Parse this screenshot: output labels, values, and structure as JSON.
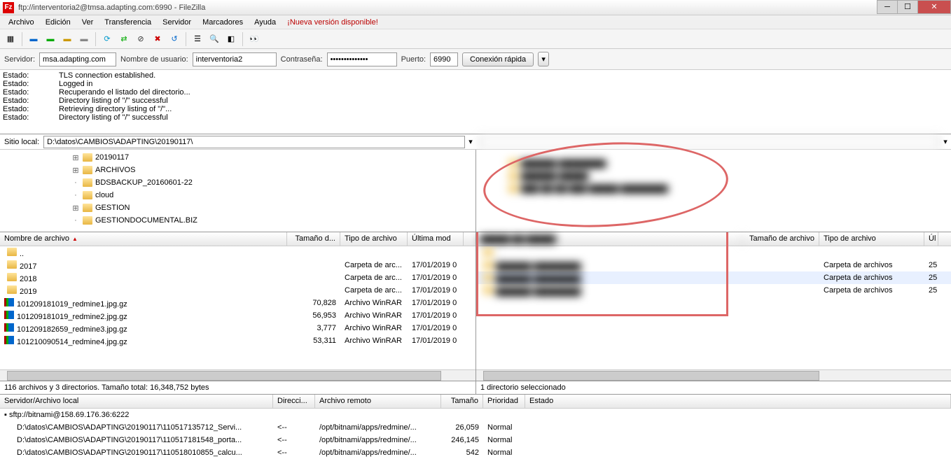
{
  "title": "ftp://interventoria2@tmsa.adapting.com:6990 - FileZilla",
  "menu": [
    "Archivo",
    "Edición",
    "Ver",
    "Transferencia",
    "Servidor",
    "Marcadores",
    "Ayuda"
  ],
  "update": "¡Nueva versión disponible!",
  "quickconnect": {
    "host_label": "Servidor:",
    "host": "msa.adapting.com",
    "user_label": "Nombre de usuario:",
    "user": "interventoria2",
    "pass_label": "Contraseña:",
    "pass": "••••••••••••••",
    "port_label": "Puerto:",
    "port": "6990",
    "button": "Conexión rápida"
  },
  "log": [
    {
      "label": "Estado:",
      "msg": "TLS connection established."
    },
    {
      "label": "Estado:",
      "msg": "Logged in"
    },
    {
      "label": "Estado:",
      "msg": "Recuperando el listado del directorio..."
    },
    {
      "label": "Estado:",
      "msg": "Directory listing of \"/\" successful"
    },
    {
      "label": "Estado:",
      "msg": "Retrieving directory listing of \"/\"..."
    },
    {
      "label": "Estado:",
      "msg": "Directory listing of \"/\" successful"
    }
  ],
  "local_path_label": "Sitio local:",
  "local_path": "D:\\datos\\CAMBIOS\\ADAPTING\\20190117\\",
  "local_tree": [
    {
      "exp": "+",
      "name": "20190117"
    },
    {
      "exp": "+",
      "name": "ARCHIVOS"
    },
    {
      "exp": "",
      "name": "BDSBACKUP_20160601-22"
    },
    {
      "exp": "",
      "name": "cloud"
    },
    {
      "exp": "+",
      "name": "GESTION"
    },
    {
      "exp": "",
      "name": "GESTIONDOCUMENTAL.BIZ"
    }
  ],
  "local_cols": {
    "name": "Nombre de archivo",
    "size": "Tamaño d...",
    "type": "Tipo de archivo",
    "mod": "Última mod"
  },
  "local_files": [
    {
      "icon": "folder",
      "name": "..",
      "size": "",
      "type": "",
      "mod": ""
    },
    {
      "icon": "folder",
      "name": "2017",
      "size": "",
      "type": "Carpeta de arc...",
      "mod": "17/01/2019 0"
    },
    {
      "icon": "folder",
      "name": "2018",
      "size": "",
      "type": "Carpeta de arc...",
      "mod": "17/01/2019 0"
    },
    {
      "icon": "folder",
      "name": "2019",
      "size": "",
      "type": "Carpeta de arc...",
      "mod": "17/01/2019 0"
    },
    {
      "icon": "gz",
      "name": "101209181019_redmine1.jpg.gz",
      "size": "70,828",
      "type": "Archivo WinRAR",
      "mod": "17/01/2019 0"
    },
    {
      "icon": "gz",
      "name": "101209181019_redmine2.jpg.gz",
      "size": "56,953",
      "type": "Archivo WinRAR",
      "mod": "17/01/2019 0"
    },
    {
      "icon": "gz",
      "name": "101209182659_redmine3.jpg.gz",
      "size": "3,777",
      "type": "Archivo WinRAR",
      "mod": "17/01/2019 0"
    },
    {
      "icon": "gz",
      "name": "101210090514_redmine4.jpg.gz",
      "size": "53,311",
      "type": "Archivo WinRAR",
      "mod": "17/01/2019 0"
    }
  ],
  "remote_cols": {
    "size": "Tamaño de archivo",
    "type": "Tipo de archivo",
    "mod": "Úl"
  },
  "remote_files": [
    {
      "type": "",
      "mod": "",
      "size": ""
    },
    {
      "type": "Carpeta de archivos",
      "mod": "25",
      "size": ""
    },
    {
      "type": "Carpeta de archivos",
      "mod": "25",
      "size": ""
    },
    {
      "type": "Carpeta de archivos",
      "mod": "25",
      "size": ""
    }
  ],
  "local_status": "116 archivos y 3 directorios. Tamaño total: 16,348,752 bytes",
  "remote_status": "1 directorio seleccionado",
  "queue_cols": {
    "local": "Servidor/Archivo local",
    "dir": "Direcci...",
    "remote": "Archivo remoto",
    "size": "Tamaño",
    "prio": "Prioridad",
    "state": "Estado"
  },
  "queue_server": "sftp://bitnami@158.69.176.36:6222",
  "queue": [
    {
      "local": "D:\\datos\\CAMBIOS\\ADAPTING\\20190117\\110517135712_Servi...",
      "dir": "<--",
      "remote": "/opt/bitnami/apps/redmine/...",
      "size": "26,059",
      "prio": "Normal"
    },
    {
      "local": "D:\\datos\\CAMBIOS\\ADAPTING\\20190117\\110517181548_porta...",
      "dir": "<--",
      "remote": "/opt/bitnami/apps/redmine/...",
      "size": "246,145",
      "prio": "Normal"
    },
    {
      "local": "D:\\datos\\CAMBIOS\\ADAPTING\\20190117\\110518010855_calcu...",
      "dir": "<--",
      "remote": "/opt/bitnami/apps/redmine/...",
      "size": "542",
      "prio": "Normal"
    }
  ]
}
